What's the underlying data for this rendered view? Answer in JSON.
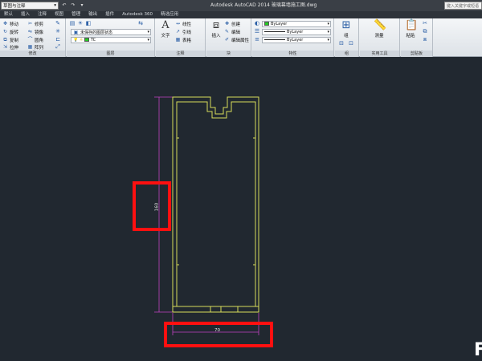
{
  "titlebar": {
    "workspace": "草图与注释",
    "title": "Autodesk AutoCAD 2014    玻璃幕墙施工图.dwg",
    "search_placeholder": "键入关键字或短语"
  },
  "tabs": [
    "默认",
    "插入",
    "注释",
    "视图",
    "管理",
    "输出",
    "插件",
    "Autodesk 360",
    "精选应用"
  ],
  "ribbon": {
    "modify": {
      "title": "修改",
      "items": [
        "移动",
        "旋转",
        "修剪",
        "复制",
        "镜像",
        "圆角",
        "拉伸",
        "缩放",
        "阵列"
      ]
    },
    "layers": {
      "title": "图层",
      "state": "未保存的图层状态",
      "layer": "TC"
    },
    "annotation": {
      "title": "注释",
      "text": "文字",
      "items": [
        "线性",
        "引线",
        "表格"
      ]
    },
    "block": {
      "title": "块",
      "insert": "插入",
      "items": [
        "创建",
        "编辑",
        "编辑属性"
      ]
    },
    "properties": {
      "title": "特性",
      "color": "ByLayer",
      "linetype": "ByLayer",
      "lineweight": "ByLayer"
    },
    "groups": {
      "title": "组",
      "label": "组"
    },
    "utilities": {
      "title": "实用工具",
      "label": "测量"
    },
    "clipboard": {
      "title": "剪贴板",
      "label": "粘贴"
    }
  },
  "drawing": {
    "dimension_vertical": "160",
    "dimension_horizontal": "70"
  }
}
